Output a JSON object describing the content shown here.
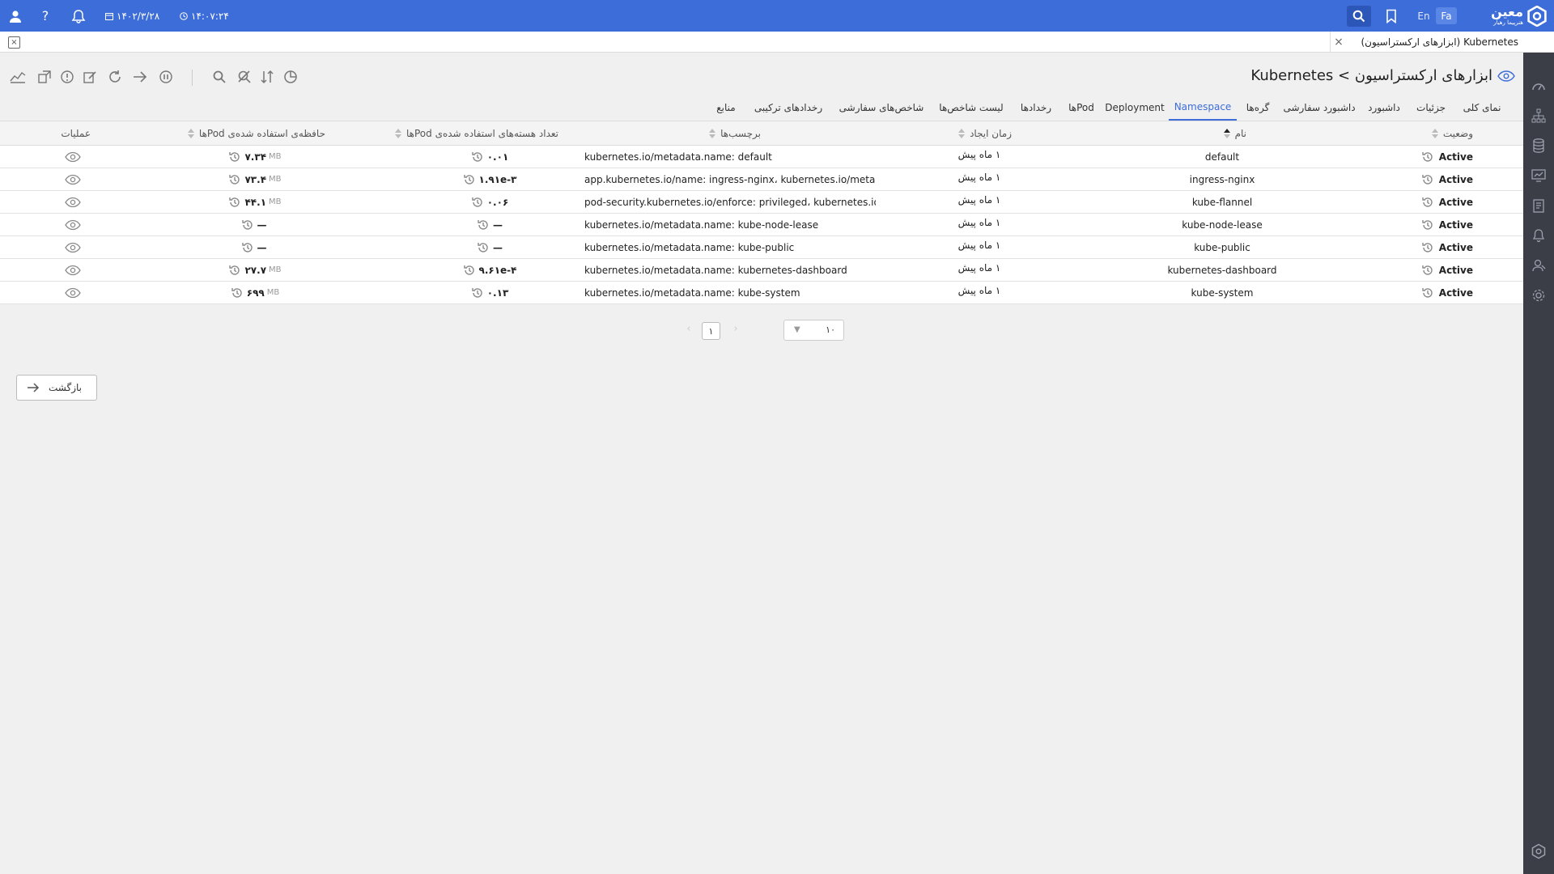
{
  "topbar": {
    "time": "۱۴:۰۷:۲۴",
    "date": "۱۴۰۲/۳/۲۸",
    "lang_en": "En",
    "lang_fa": "Fa",
    "brand_name": "معین",
    "brand_sub": "هنرپیما رهیار"
  },
  "tabstrip": {
    "active_tab": "Kubernetes (ابزارهای ارکستراسیون)",
    "close": "×",
    "close_all": "×"
  },
  "page": {
    "title": "ابزارهای ارکستراسیون > Kubernetes"
  },
  "subnav": [
    {
      "label": "نمای کلی",
      "active": false
    },
    {
      "label": "جزئیات",
      "active": false
    },
    {
      "label": "داشبورد",
      "active": false
    },
    {
      "label": "داشبورد سفارشی",
      "active": false
    },
    {
      "label": "گره‌ها",
      "active": false
    },
    {
      "label": "Namespace",
      "active": true
    },
    {
      "label": "Deployment",
      "active": false
    },
    {
      "label": "Podها",
      "active": false
    },
    {
      "label": "رخدادها",
      "active": false
    },
    {
      "label": "لیست شاخص‌ها",
      "active": false
    },
    {
      "label": "شاخص‌های سفارشی",
      "active": false
    },
    {
      "label": "رخدادهای ترکیبی",
      "active": false
    },
    {
      "label": "منابع",
      "active": false
    }
  ],
  "table": {
    "headers": {
      "status": "وضعیت",
      "name": "نام",
      "created": "زمان ایجاد",
      "labels": "برچسب‌ها",
      "cpu": "تعداد هسته‌های استفاده شده‌ی Podها",
      "memory": "حافظه‌ی استفاده شده‌ی Podها",
      "actions": "عملیات"
    },
    "rows": [
      {
        "status": "Active",
        "name": "default",
        "created": "۱ ماه پیش",
        "labels": "kubernetes.io/metadata.name: default",
        "cpu": "۰.۰۱",
        "memory": "۷.۳۴",
        "memory_unit": "MB"
      },
      {
        "status": "Active",
        "name": "ingress-nginx",
        "created": "۱ ماه پیش",
        "labels": "app.kubernetes.io/name: ingress-nginx، kubernetes.io/metada...",
        "cpu": "۱.۹۱e-۳",
        "memory": "۷۳.۴",
        "memory_unit": "MB"
      },
      {
        "status": "Active",
        "name": "kube-flannel",
        "created": "۱ ماه پیش",
        "labels": "pod-security.kubernetes.io/enforce: privileged، kubernetes.io/...",
        "cpu": "۰.۰۶",
        "memory": "۴۴.۱",
        "memory_unit": "MB"
      },
      {
        "status": "Active",
        "name": "kube-node-lease",
        "created": "۱ ماه پیش",
        "labels": "kubernetes.io/metadata.name: kube-node-lease",
        "cpu": "—",
        "memory": "—",
        "memory_unit": ""
      },
      {
        "status": "Active",
        "name": "kube-public",
        "created": "۱ ماه پیش",
        "labels": "kubernetes.io/metadata.name: kube-public",
        "cpu": "—",
        "memory": "—",
        "memory_unit": ""
      },
      {
        "status": "Active",
        "name": "kubernetes-dashboard",
        "created": "۱ ماه پیش",
        "labels": "kubernetes.io/metadata.name: kubernetes-dashboard",
        "cpu": "۹.۶۱e-۴",
        "memory": "۲۷.۷",
        "memory_unit": "MB"
      },
      {
        "status": "Active",
        "name": "kube-system",
        "created": "۱ ماه پیش",
        "labels": "kubernetes.io/metadata.name: kube-system",
        "cpu": "۰.۱۳",
        "memory": "۶۹۹",
        "memory_unit": "MB"
      }
    ]
  },
  "pagination": {
    "page_size": "۱۰",
    "current_page": "۱",
    "prev": "‹",
    "next": "›"
  },
  "back_button": "بازگشت",
  "colors": {
    "brand": "#3d6dd8",
    "sidebar": "#3c3e47",
    "background": "#f0f0f0"
  }
}
